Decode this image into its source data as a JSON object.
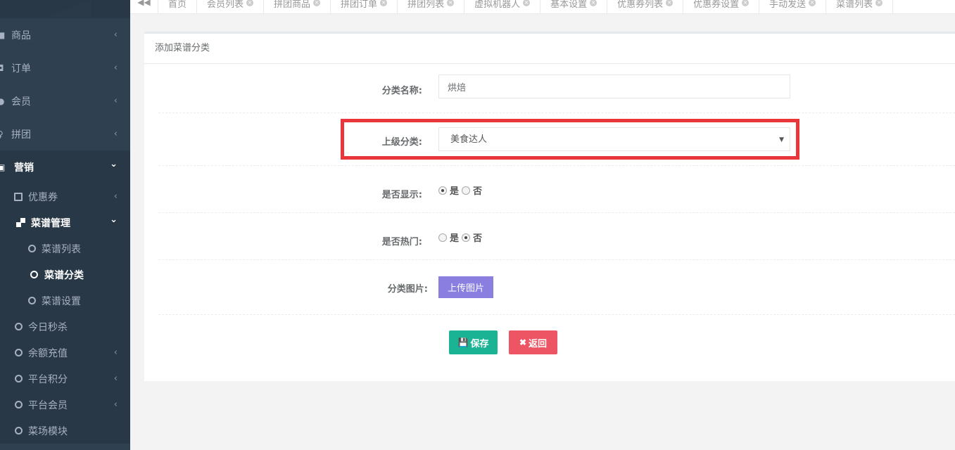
{
  "sidebar": {
    "items": [
      {
        "icon": "bag-icon",
        "label": "商品"
      },
      {
        "icon": "receipt-icon",
        "label": "订单"
      },
      {
        "icon": "users-icon",
        "label": "会员"
      },
      {
        "icon": "group-icon",
        "label": "拼团"
      },
      {
        "icon": "gift-icon",
        "label": "营销"
      }
    ],
    "marketing_sub": [
      {
        "label": "优惠券",
        "icon": "ticket-icon"
      },
      {
        "label": "菜谱管理",
        "icon": "grid-icon"
      }
    ],
    "recipe_sub": [
      {
        "label": "菜谱列表"
      },
      {
        "label": "菜谱分类"
      },
      {
        "label": "菜谱设置"
      }
    ],
    "other_sub": [
      {
        "label": "今日秒杀"
      },
      {
        "label": "余额充值"
      },
      {
        "label": "平台积分"
      },
      {
        "label": "平台会员"
      },
      {
        "label": "菜场模块"
      }
    ],
    "arrow_left": "‹",
    "arrow_down": "⌄"
  },
  "tabs": [
    {
      "label": "首页"
    },
    {
      "label": "会员列表"
    },
    {
      "label": "拼团商品"
    },
    {
      "label": "拼团订单"
    },
    {
      "label": "拼团列表"
    },
    {
      "label": "虚拟机器人"
    },
    {
      "label": "基本设置"
    },
    {
      "label": "优惠券列表"
    },
    {
      "label": "优惠券设置"
    },
    {
      "label": "手动发送"
    },
    {
      "label": "菜谱列表"
    }
  ],
  "tab_back": "◀◀",
  "tab_close": "×",
  "panel": {
    "title": "添加菜谱分类",
    "name_label": "分类名称:",
    "name_value": "烘焙",
    "parent_label": "上级分类:",
    "parent_value": "美食达人",
    "caret": "▼",
    "show_label": "是否显示:",
    "hot_label": "是否热门:",
    "yes": "是",
    "no": "否",
    "image_label": "分类图片:",
    "upload_label": "上传图片",
    "save_label": "保存",
    "back_label": "返回",
    "save_icon": "💾",
    "back_icon": "✖"
  },
  "colors": {
    "sidebar_bg": "#2f4050",
    "save_btn": "#1ab394",
    "back_btn": "#ed5565",
    "upload_btn": "#8a7fe0",
    "highlight": "#e8363a"
  }
}
